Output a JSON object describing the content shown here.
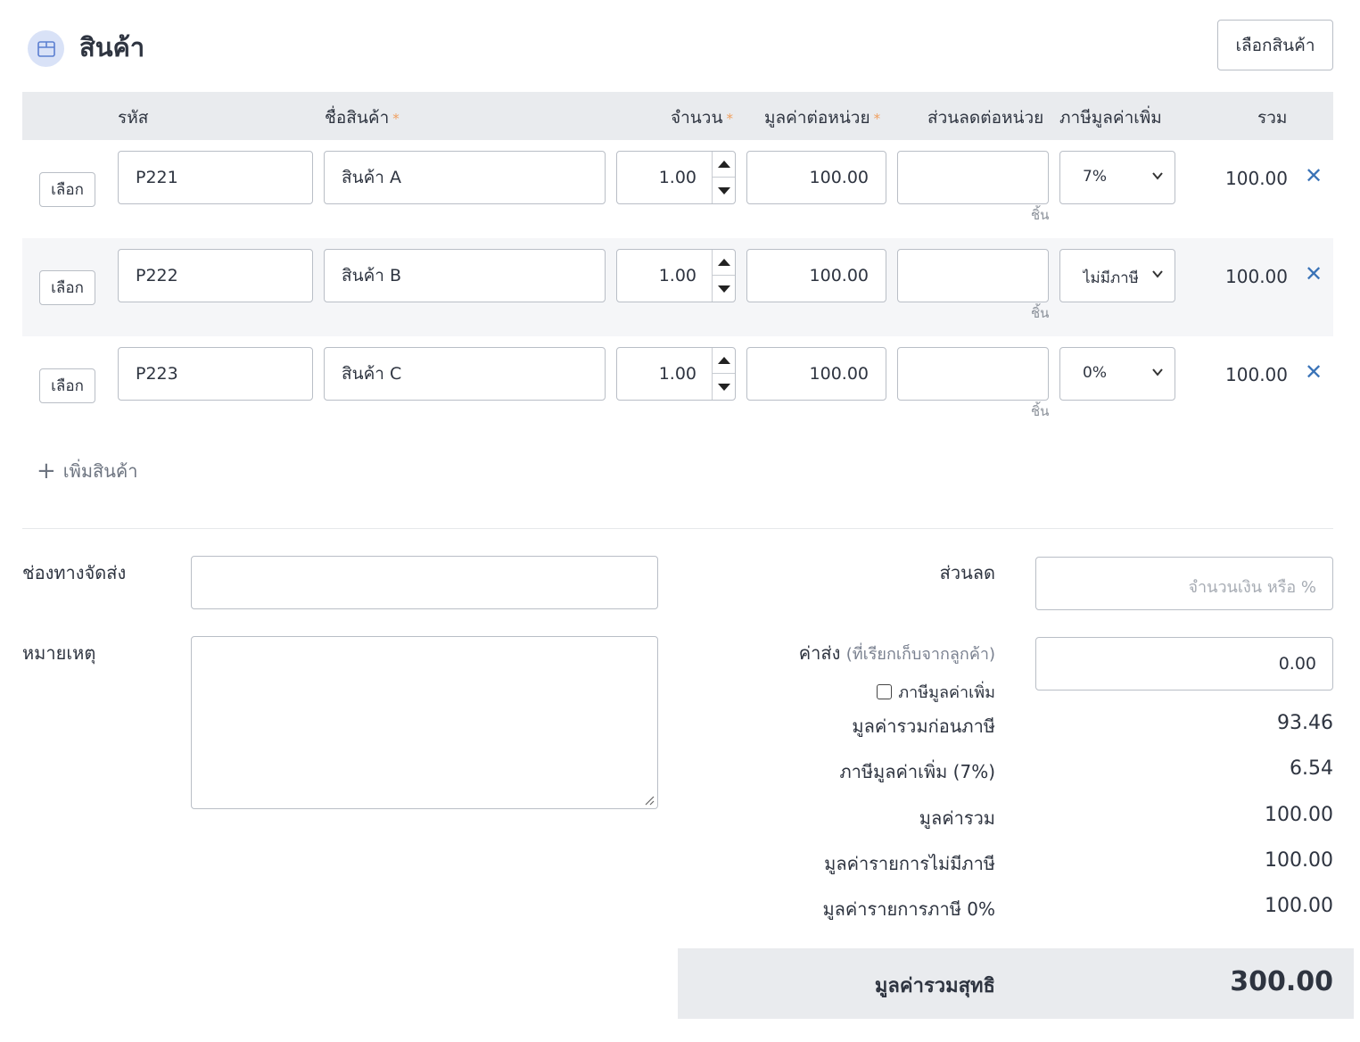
{
  "header": {
    "title": "สินค้า",
    "select_button": "เลือกสินค้า"
  },
  "table": {
    "columns": {
      "code": "รหัส",
      "name": "ชื่อสินค้า",
      "qty": "จำนวน",
      "unit_price": "มูลค่าต่อหน่วย",
      "discount": "ส่วนลดต่อหน่วย",
      "vat": "ภาษีมูลค่าเพิ่ม",
      "total": "รวม"
    },
    "required_mark": "*",
    "pick_label": "เลือก",
    "unit_label": "ชิ้น",
    "remove_symbol": "✕",
    "rows": [
      {
        "code": "P221",
        "name": "สินค้า A",
        "qty": "1.00",
        "unit_price": "100.00",
        "discount": "",
        "vat": "7%",
        "total": "100.00"
      },
      {
        "code": "P222",
        "name": "สินค้า B",
        "qty": "1.00",
        "unit_price": "100.00",
        "discount": "",
        "vat": "ไม่มีภาษี",
        "total": "100.00"
      },
      {
        "code": "P223",
        "name": "สินค้า C",
        "qty": "1.00",
        "unit_price": "100.00",
        "discount": "",
        "vat": "0%",
        "total": "100.00"
      }
    ]
  },
  "add_product": "เพิ่มสินค้า",
  "form": {
    "shipping_channel_label": "ช่องทางจัดส่ง",
    "shipping_channel_value": "",
    "note_label": "หมายเหตุ",
    "note_value": "",
    "discount_label": "ส่วนลด",
    "discount_placeholder": "จำนวนเงิน หรือ %",
    "shipping_fee_label": "ค่าส่ง",
    "shipping_fee_hint": "(ที่เรียกเก็บจากลูกค้า)",
    "shipping_fee_value": "0.00",
    "shipping_vat_checkbox": "ภาษีมูลค่าเพิ่ม"
  },
  "summary": {
    "pre_tax_label": "มูลค่ารวมก่อนภาษี",
    "pre_tax_value": "93.46",
    "vat_label": "ภาษีมูลค่าเพิ่ม (7%)",
    "vat_value": "6.54",
    "total_label": "มูลค่ารวม",
    "total_value": "100.00",
    "non_vat_label": "มูลค่ารายการไม่มีภาษี",
    "non_vat_value": "100.00",
    "zero_vat_label": "มูลค่ารายการภาษี 0%",
    "zero_vat_value": "100.00",
    "net_label": "มูลค่ารวมสุทธิ",
    "net_value": "300.00"
  }
}
